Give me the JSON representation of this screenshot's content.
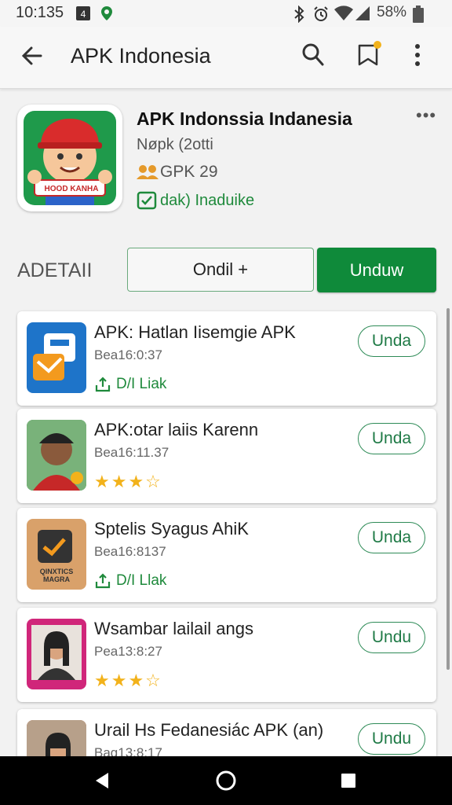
{
  "status_bar": {
    "time": "10:135",
    "battery_text": "58%",
    "icons": [
      "notification-icon",
      "location-icon",
      "bluetooth-icon",
      "alarm-icon",
      "wifi-icon",
      "signal-icon",
      "battery-icon"
    ]
  },
  "app_bar": {
    "title": "APK Indonesia",
    "icons": [
      "back-arrow-icon",
      "search-icon",
      "bookmark-icon",
      "more-vert-icon"
    ]
  },
  "app": {
    "title": "APK Indonssia Indanesia",
    "subtitle": "Nøpk (2otti",
    "rating": "GPK 29",
    "downloads": "dak) Inaduike",
    "icon_text": "HOOD KANHA",
    "more": "•••"
  },
  "detail_row": {
    "label": "ADETAII",
    "outline_button": "Ondil +",
    "solid_button": "Unduw"
  },
  "list": [
    {
      "title": "APK: Hatlan Iisemgie APK",
      "meta": "Bea16:0:37",
      "foot": "D/I Liak",
      "foot_type": "download",
      "button": "Unda"
    },
    {
      "title": "APK:otar laiis Karenn",
      "meta": "Bea16:11.37",
      "stars": "★★★☆",
      "foot_type": "stars",
      "button": "Unda"
    },
    {
      "title": "Sptelis Syagus AhiK",
      "meta": "Bea16:8137",
      "foot": "D/I Llak",
      "foot_type": "download",
      "button": "Unda",
      "thumb_text": "QINXTICS MAGRA"
    },
    {
      "title": "Wsambar lailail angs",
      "meta": "Pea13:8:27",
      "stars": "★★★☆",
      "foot_type": "stars",
      "button": "Undu"
    },
    {
      "title": "Urail Hs Fedanesiác APK (an)",
      "meta": "Bag13:8:17",
      "foot_type": "none",
      "button": "Undu"
    }
  ],
  "nav_bar": {
    "icons": [
      "back-nav-icon",
      "home-nav-icon",
      "recents-nav-icon"
    ]
  },
  "colors": {
    "accent": "#0f8a3a",
    "outline": "#2e8b57",
    "star": "#f2b21b"
  }
}
